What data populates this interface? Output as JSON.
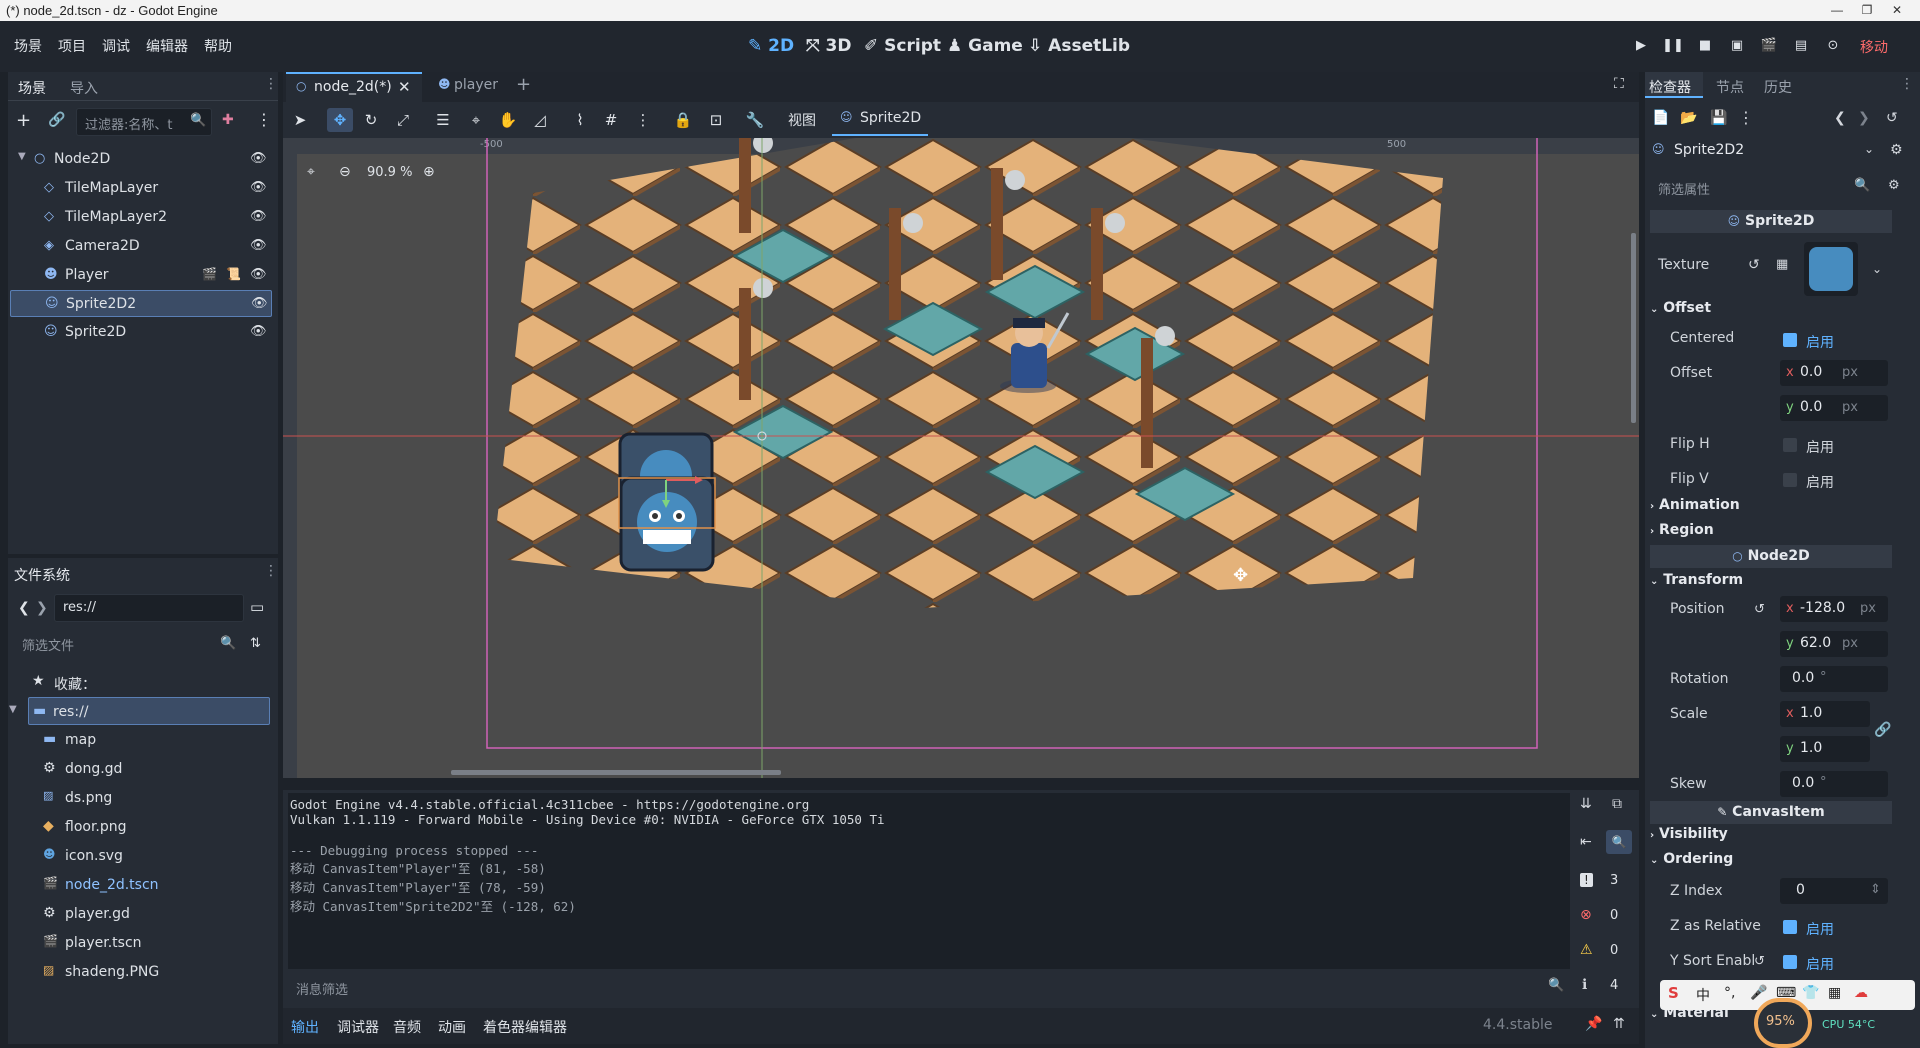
{
  "window": {
    "title": "(*) node_2d.tscn - dz - Godot Engine",
    "controls": [
      "—",
      "❐",
      "✕"
    ]
  },
  "menu": {
    "items": [
      "场景",
      "项目",
      "调试",
      "编辑器",
      "帮助"
    ],
    "workspaces": [
      "2D",
      "3D",
      "Script",
      "Game",
      "AssetLib"
    ],
    "renderer": "移动"
  },
  "scene_dock": {
    "tabs": [
      "场景",
      "导入"
    ],
    "filter_placeholder": "过滤器:名称、t",
    "nodes": [
      {
        "label": "Node2D",
        "icon": "circle-node-icon"
      },
      {
        "label": "TileMapLayer",
        "icon": "tilemap-icon"
      },
      {
        "label": "TileMapLayer2",
        "icon": "tilemap-icon"
      },
      {
        "label": "Camera2D",
        "icon": "camera-icon"
      },
      {
        "label": "Player",
        "icon": "character-icon"
      },
      {
        "label": "Sprite2D2",
        "icon": "sprite-icon"
      },
      {
        "label": "Sprite2D",
        "icon": "sprite-icon"
      }
    ]
  },
  "filesystem": {
    "title": "文件系统",
    "path": "res://",
    "filter_placeholder": "筛选文件",
    "favorites": "收藏：",
    "root": "res://",
    "items": [
      {
        "label": "map",
        "icon": "folder-icon"
      },
      {
        "label": "dong.gd",
        "icon": "gear-icon"
      },
      {
        "label": "ds.png",
        "icon": "image-icon"
      },
      {
        "label": "floor.png",
        "icon": "image-icon"
      },
      {
        "label": "icon.svg",
        "icon": "godot-icon"
      },
      {
        "label": "node_2d.tscn",
        "icon": "scene-icon"
      },
      {
        "label": "player.gd",
        "icon": "gear-icon"
      },
      {
        "label": "player.tscn",
        "icon": "scene-icon"
      },
      {
        "label": "shadeng.PNG",
        "icon": "image-icon"
      }
    ]
  },
  "editor_tabs": [
    "node_2d(*)",
    "player"
  ],
  "toolbar": {
    "view_label": "视图",
    "sprite_label": "Sprite2D",
    "zoom": "90.9 %"
  },
  "ruler": {
    "marks": [
      "-500",
      "0",
      "500"
    ]
  },
  "output": {
    "lines": [
      "Godot Engine v4.4.stable.official.4c311cbee - https://godotengine.org",
      "Vulkan 1.1.119 - Forward Mobile - Using Device #0: NVIDIA - GeForce GTX 1050 Ti",
      "",
      "--- Debugging process stopped ---",
      "移动 CanvasItem\"Player\"至 (81, -58)",
      "移动 CanvasItem\"Player\"至 (78, -59)",
      "移动 CanvasItem\"Sprite2D2\"至 (-128, 62)"
    ],
    "counts": [
      "3",
      "0",
      "0",
      "4"
    ],
    "filter_placeholder": "消息筛选"
  },
  "bottom_tabs": [
    "输出",
    "调试器",
    "音频",
    "动画",
    "着色器编辑器"
  ],
  "version": "4.4.stable",
  "inspector": {
    "tabs": [
      "检查器",
      "节点",
      "历史"
    ],
    "node_name": "Sprite2D2",
    "filter_placeholder": "筛选属性",
    "class_sprite": "Sprite2D",
    "texture_label": "Texture",
    "offset_section": "Offset",
    "centered_label": "Centered",
    "enable": "启用",
    "offset_label": "Offset",
    "offset_x": "0.0",
    "offset_y": "0.0",
    "unit_px": "px",
    "fliph_label": "Flip H",
    "flipv_label": "Flip V",
    "animation_section": "Animation",
    "region_section": "Region",
    "class_node2d": "Node2D",
    "transform_section": "Transform",
    "position_label": "Position",
    "pos_x": "-128.0",
    "pos_y": "62.0",
    "rotation_label": "Rotation",
    "rotation": "0.0",
    "deg": "°",
    "scale_label": "Scale",
    "scale_x": "1.0",
    "scale_y": "1.0",
    "skew_label": "Skew",
    "skew": "0.0",
    "class_canvas": "CanvasItem",
    "visibility_section": "Visibility",
    "ordering_section": "Ordering",
    "zindex_label": "Z Index",
    "zindex": "0",
    "zrel_label": "Z as Relative",
    "ysort_label": "Y Sort Enabl",
    "material_section": "Material"
  },
  "tray": {
    "ime": "中",
    "battery": "95%",
    "cpu": "CPU 54°C"
  },
  "colors": {
    "accent": "#5fb2ff",
    "bg": "#262c35",
    "selection": "#3b4c66"
  }
}
